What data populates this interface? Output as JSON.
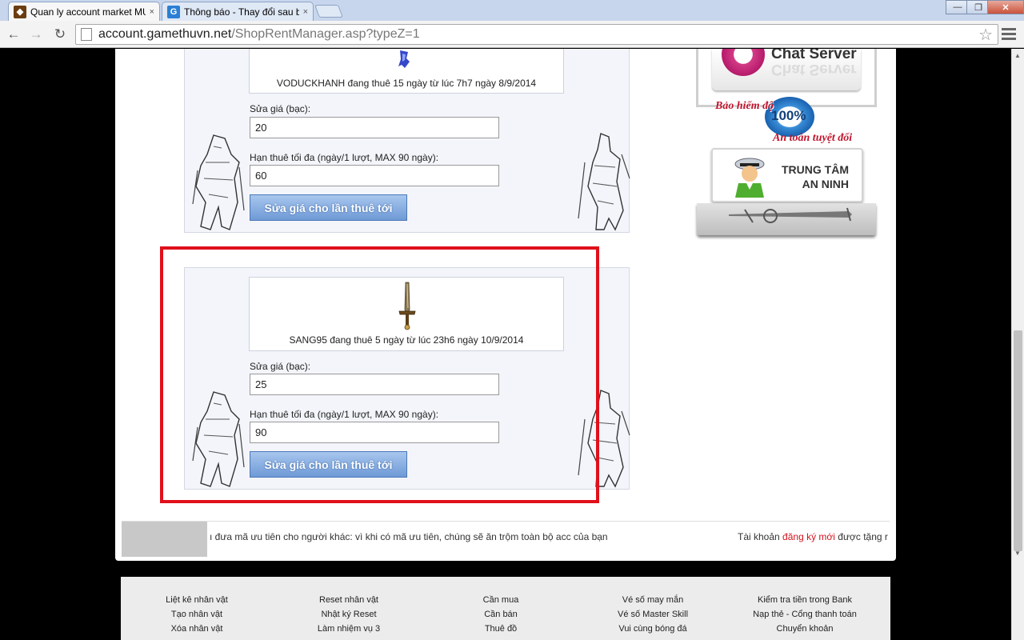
{
  "browser": {
    "tabs": [
      {
        "title": "Quan ly account market MU S",
        "close": "×"
      },
      {
        "title": "Thông báo - Thay đổi sau bả",
        "close": "×"
      }
    ],
    "favicon_letter": "G",
    "url_host": "account.gamethuvn.net",
    "url_path": "/ShopRentManager.asp?typeZ=1",
    "window_controls": {
      "minimize": "—",
      "maximize": "❐",
      "close": "✕"
    }
  },
  "rent_cards": [
    {
      "renter_text": "VODUCKHANH đang thuê 15 ngày từ lúc 7h7 ngày 8/9/2014",
      "price_label": "Sửa giá (bạc):",
      "price_value": "20",
      "limit_label": "Hạn thuê tối đa (ngày/1 lượt, MAX 90 ngày):",
      "limit_value": "60",
      "submit_label": "Sửa giá cho lần thuê tới"
    },
    {
      "renter_text": "SANG95 đang thuê 5 ngày từ lúc 23h6 ngày 10/9/2014",
      "price_label": "Sửa giá (bạc):",
      "price_value": "25",
      "limit_label": "Hạn thuê tối đa (ngày/1 lượt, MAX 90 ngày):",
      "limit_value": "90",
      "submit_label": "Sửa giá cho lần thuê tới"
    }
  ],
  "sidebar": {
    "chat_server": "Chat Server",
    "insurance_line1": "Bảo hiểm độ",
    "insurance_pct": "100%",
    "insurance_line2": "An toàn tuyệt đối",
    "security_line1": "TRUNG TÂM",
    "security_line2": "AN NINH"
  },
  "ticker": {
    "message": "ı đưa mã ưu tiên cho người khác: vì khi có mã ưu tiên, chúng sẽ ăn trộm toàn bộ acc của bạn",
    "register_prefix": "Tài khoản ",
    "register_link": "đăng ký mới",
    "register_suffix": " được tặng r"
  },
  "footer": {
    "columns": [
      [
        "Liệt kê nhân vật",
        "Tạo nhân vật",
        "Xóa nhân vật"
      ],
      [
        "Reset nhân vật",
        "Nhật ký Reset",
        "Làm nhiệm vụ 3"
      ],
      [
        "Cần mua",
        "Cần bán",
        "Thuê đồ"
      ],
      [
        "Vé số may mắn",
        "Vé số Master Skill",
        "Vui cùng bóng đá"
      ],
      [
        "Kiểm tra tiền trong Bank",
        "Nạp thẻ - Cổng thanh toán",
        "Chuyển khoản"
      ]
    ]
  },
  "colors": {
    "highlight": "#e0101a",
    "button": "#6f9ad6",
    "link_red": "#d2141e"
  }
}
